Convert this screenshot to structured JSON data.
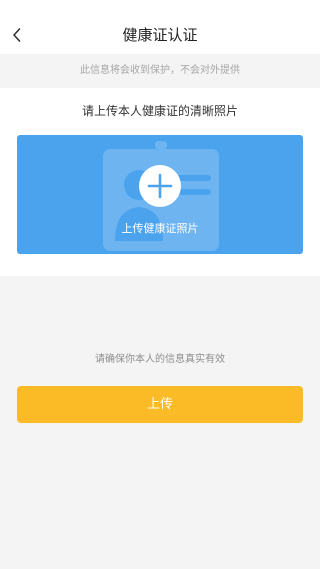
{
  "navbar": {
    "back_icon": "chevron-left-icon",
    "title": "健康证认证"
  },
  "privacy_note": "此信息将会收到保护，不会对外提供",
  "upload": {
    "heading": "请上传本人健康证的清晰照片",
    "caption": "上传健康证照片",
    "icon": "plus-icon",
    "illustration_icon": "id-card-icon"
  },
  "bottom_hint": "请确保你本人的信息真实有效",
  "submit_label": "上传",
  "colors": {
    "accent_blue": "#4ba3ee",
    "button_yellow": "#fbbb26",
    "page_background": "#f4f4f4"
  }
}
